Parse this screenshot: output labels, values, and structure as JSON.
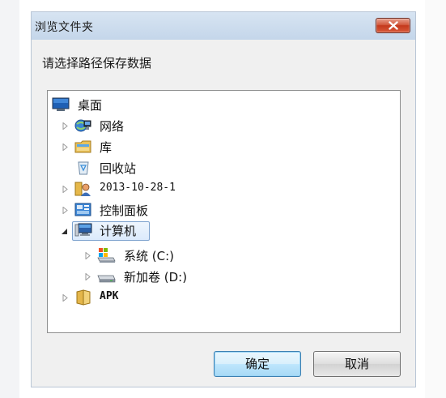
{
  "dialog": {
    "title": "浏览文件夹",
    "prompt": "请选择路径保存数据",
    "ok_label": "确定",
    "cancel_label": "取消"
  },
  "tree": {
    "items": [
      {
        "label": "桌面",
        "icon": "desktop-icon",
        "expander": "none"
      },
      {
        "label": "网络",
        "icon": "network-icon",
        "expander": "collapsed"
      },
      {
        "label": "库",
        "icon": "library-icon",
        "expander": "collapsed"
      },
      {
        "label": "回收站",
        "icon": "recycle-bin-icon",
        "expander": "none"
      },
      {
        "label": "2013-10-28-1",
        "icon": "user-folder-icon",
        "expander": "collapsed"
      },
      {
        "label": "控制面板",
        "icon": "control-panel-icon",
        "expander": "collapsed"
      },
      {
        "label": "计算机",
        "icon": "computer-icon",
        "expander": "expanded",
        "selected": true
      },
      {
        "label": "系统 (C:)",
        "icon": "system-drive-icon",
        "expander": "collapsed"
      },
      {
        "label": "新加卷 (D:)",
        "icon": "drive-icon",
        "expander": "collapsed"
      },
      {
        "label": "APK",
        "icon": "folder-icon",
        "expander": "collapsed"
      }
    ]
  },
  "colors": {
    "titlebar": "#c9d9ec",
    "close_button": "#c4391d",
    "selection_border": "#7da2ce",
    "default_button_border": "#3c7fb1"
  }
}
